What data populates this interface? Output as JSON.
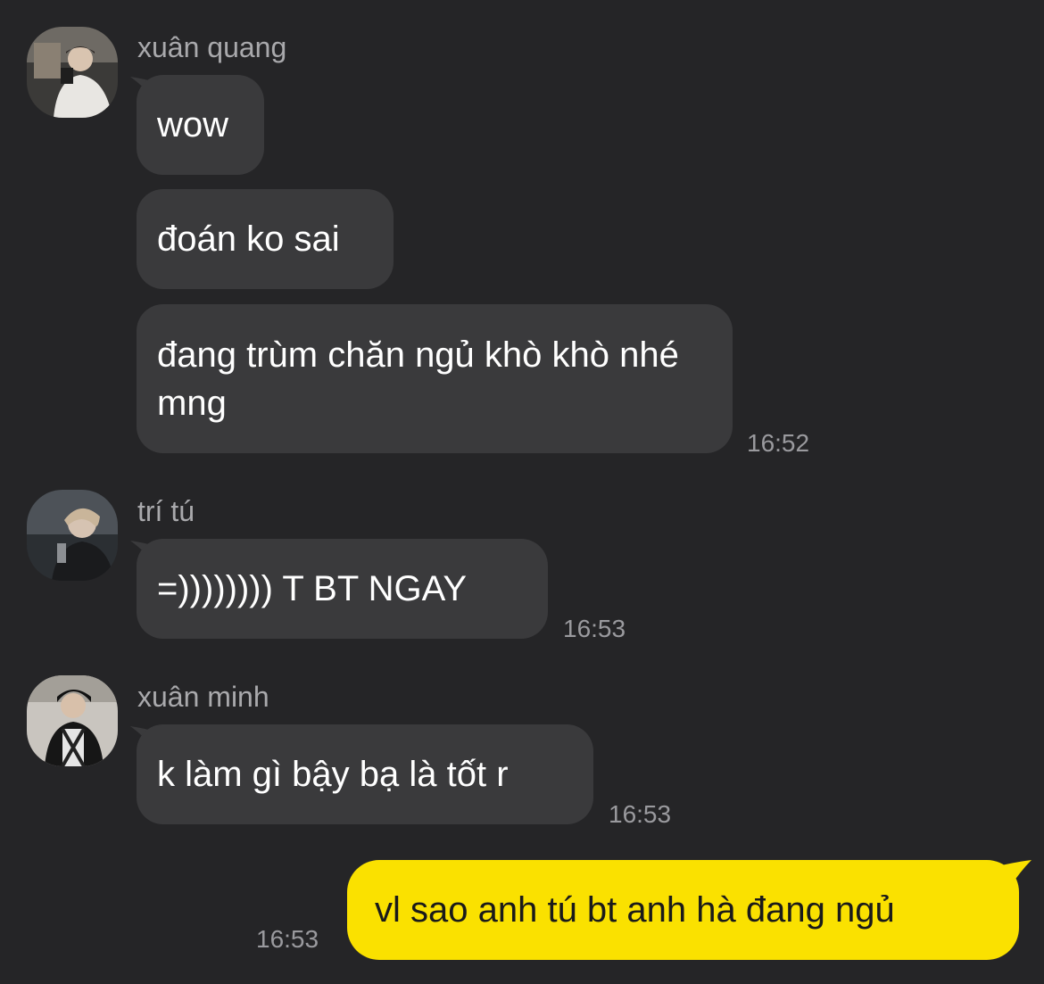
{
  "colors": {
    "background": "#252527",
    "incoming_bubble": "#3a3a3c",
    "outgoing_bubble": "#fae100",
    "sender_name": "#a9a9ac",
    "timestamp": "#9a9a9e"
  },
  "messages": [
    {
      "sender": "xuân quang",
      "avatar_icon": "user-avatar-photo",
      "bubbles": [
        "wow",
        "đoán ko sai",
        "đang trùm chăn ngủ khò khò nhé mng"
      ],
      "time": "16:52"
    },
    {
      "sender": "trí tú",
      "avatar_icon": "user-avatar-photo",
      "bubbles": [
        "=)))))))) T BT NGAY"
      ],
      "time": "16:53"
    },
    {
      "sender": "xuân minh",
      "avatar_icon": "user-avatar-photo",
      "bubbles": [
        "k làm gì bậy bạ là tốt r"
      ],
      "time": "16:53"
    }
  ],
  "outgoing": {
    "text": "vl sao anh tú bt anh hà đang ngủ",
    "time": "16:53"
  }
}
